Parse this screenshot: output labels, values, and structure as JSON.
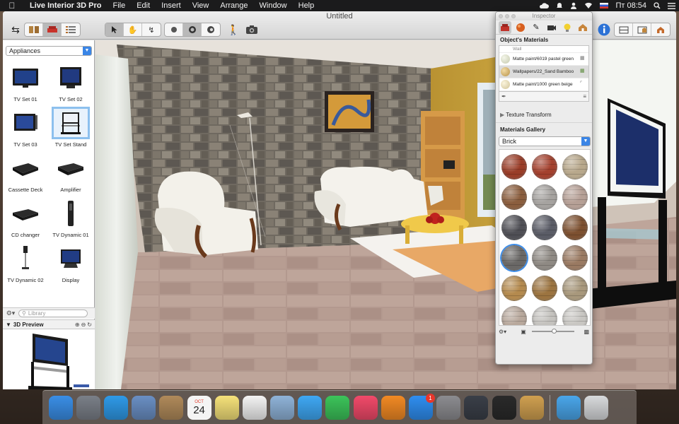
{
  "menubar": {
    "app_name": "Live Interior 3D Pro",
    "menus": [
      "File",
      "Edit",
      "Insert",
      "View",
      "Arrange",
      "Window",
      "Help"
    ],
    "clock": "Пт 08:54"
  },
  "window": {
    "title": "Untitled"
  },
  "library": {
    "category": "Appliances",
    "items": [
      {
        "label": "TV Set 01",
        "icon": "tv-set-01-icon"
      },
      {
        "label": "TV Set 02",
        "icon": "tv-set-02-icon"
      },
      {
        "label": "TV Set 03",
        "icon": "tv-set-03-icon"
      },
      {
        "label": "TV Set Stand",
        "icon": "tv-set-stand-icon",
        "selected": true
      },
      {
        "label": "Cassette Deck",
        "icon": "cassette-deck-icon"
      },
      {
        "label": "Amplifier",
        "icon": "amplifier-icon"
      },
      {
        "label": "CD changer",
        "icon": "cd-changer-icon"
      },
      {
        "label": "TV Dynamic 01",
        "icon": "tv-dynamic-01-icon"
      },
      {
        "label": "TV Dynamic 02",
        "icon": "tv-dynamic-02-icon"
      },
      {
        "label": "Display",
        "icon": "display-icon"
      }
    ],
    "search_placeholder": "Library",
    "preview_title": "3D Preview"
  },
  "inspector": {
    "title": "Inspector",
    "objects_materials_title": "Object's Materials",
    "materials": [
      {
        "name": "Wall",
        "color": "#e9e6dc"
      },
      {
        "name": "Matte paint/6019 pastel green",
        "color": "#d8dcc4"
      },
      {
        "name": "Wallpapers/22_Sand Bamboo",
        "color": "#d8c08a",
        "selected": true
      },
      {
        "name": "Matte paint/1000 green beige",
        "color": "#e6dcb8"
      }
    ],
    "texture_transform_label": "Texture Transform",
    "gallery_title": "Materials Gallery",
    "gallery_category": "Brick",
    "gallery": [
      {
        "color": "#9a3d28",
        "selected": false
      },
      {
        "color": "#a4412e",
        "selected": false
      },
      {
        "color": "#b8a88c",
        "selected": false
      },
      {
        "color": "#8b5e3e",
        "selected": false
      },
      {
        "color": "#a6a3a0",
        "selected": false
      },
      {
        "color": "#b6a096",
        "selected": false
      },
      {
        "color": "#4f4f55",
        "selected": false
      },
      {
        "color": "#5a5c66",
        "selected": false
      },
      {
        "color": "#7d5030",
        "selected": false
      },
      {
        "color": "#6a6866",
        "selected": true
      },
      {
        "color": "#8f8a84",
        "selected": false
      },
      {
        "color": "#9a7a62",
        "selected": false
      },
      {
        "color": "#b48a4e",
        "selected": false
      },
      {
        "color": "#9c7440",
        "selected": false
      },
      {
        "color": "#a8987c",
        "selected": false
      },
      {
        "color": "#b8a89c",
        "selected": false
      },
      {
        "color": "#c4c2be",
        "selected": false
      },
      {
        "color": "#c8c6c2",
        "selected": false
      }
    ]
  },
  "dock": {
    "apps": [
      {
        "name": "finder-icon",
        "color": "#3a8ee6"
      },
      {
        "name": "launchpad-icon",
        "color": "#7a7f88"
      },
      {
        "name": "safari-icon",
        "color": "#2f9ae8"
      },
      {
        "name": "mail-stamp-icon",
        "color": "#6a8fc4"
      },
      {
        "name": "contacts-icon",
        "color": "#b08a5a"
      },
      {
        "name": "calendar-icon",
        "color": "#f3f3f3",
        "month": "OCT",
        "day": "24"
      },
      {
        "name": "notes-icon",
        "color": "#f6e27a"
      },
      {
        "name": "reminders-icon",
        "color": "#f4f4f4"
      },
      {
        "name": "preview-icon",
        "color": "#8fb3d8"
      },
      {
        "name": "messages-icon",
        "color": "#3fa8f4"
      },
      {
        "name": "facetime-icon",
        "color": "#3cc45a"
      },
      {
        "name": "itunes-icon",
        "color": "#f24a6a"
      },
      {
        "name": "ibooks-icon",
        "color": "#f28a24"
      },
      {
        "name": "app-store-icon",
        "color": "#2f8ef0",
        "badge": "1"
      },
      {
        "name": "system-preferences-icon",
        "color": "#8c8c90"
      },
      {
        "name": "activity-monitor-icon",
        "color": "#3a3f48"
      },
      {
        "name": "font-book-icon",
        "color": "#2a2a2a"
      },
      {
        "name": "live-interior-3d-icon",
        "color": "#d0a050"
      }
    ],
    "right": [
      {
        "name": "downloads-folder-icon",
        "color": "#4aa6ea"
      },
      {
        "name": "trash-icon",
        "color": "#d8dadc"
      }
    ]
  },
  "colors": {
    "accent": "#3a85e6",
    "menubar": "#1b1b1c"
  }
}
